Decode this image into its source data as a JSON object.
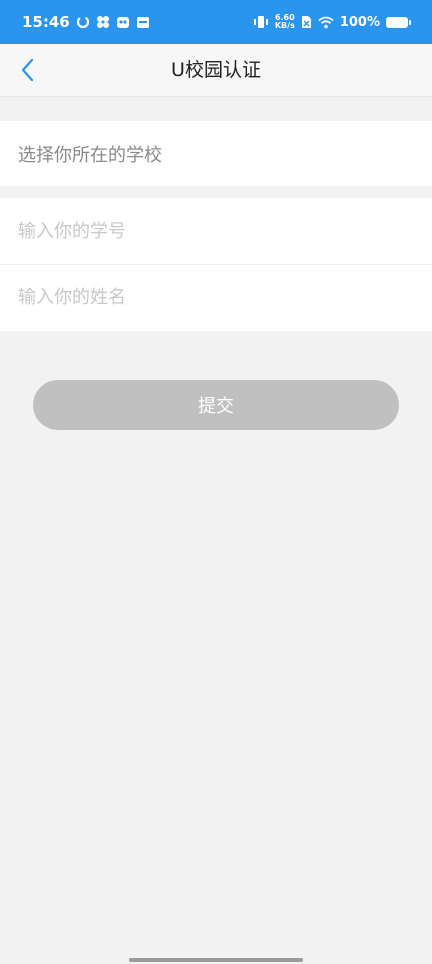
{
  "status_bar": {
    "time": "15:46",
    "net_speed_value": "6.60",
    "net_speed_unit": "KB/s",
    "battery_percent": "100%"
  },
  "nav": {
    "title": "U校园认证"
  },
  "form": {
    "school_placeholder": "选择你所在的学校",
    "student_id_placeholder": "输入你的学号",
    "name_placeholder": "输入你的姓名",
    "submit_label": "提交"
  },
  "colors": {
    "status_bar": "#2a95ee",
    "back_icon": "#2a95ee",
    "submit_disabled": "#c0c0c0"
  }
}
